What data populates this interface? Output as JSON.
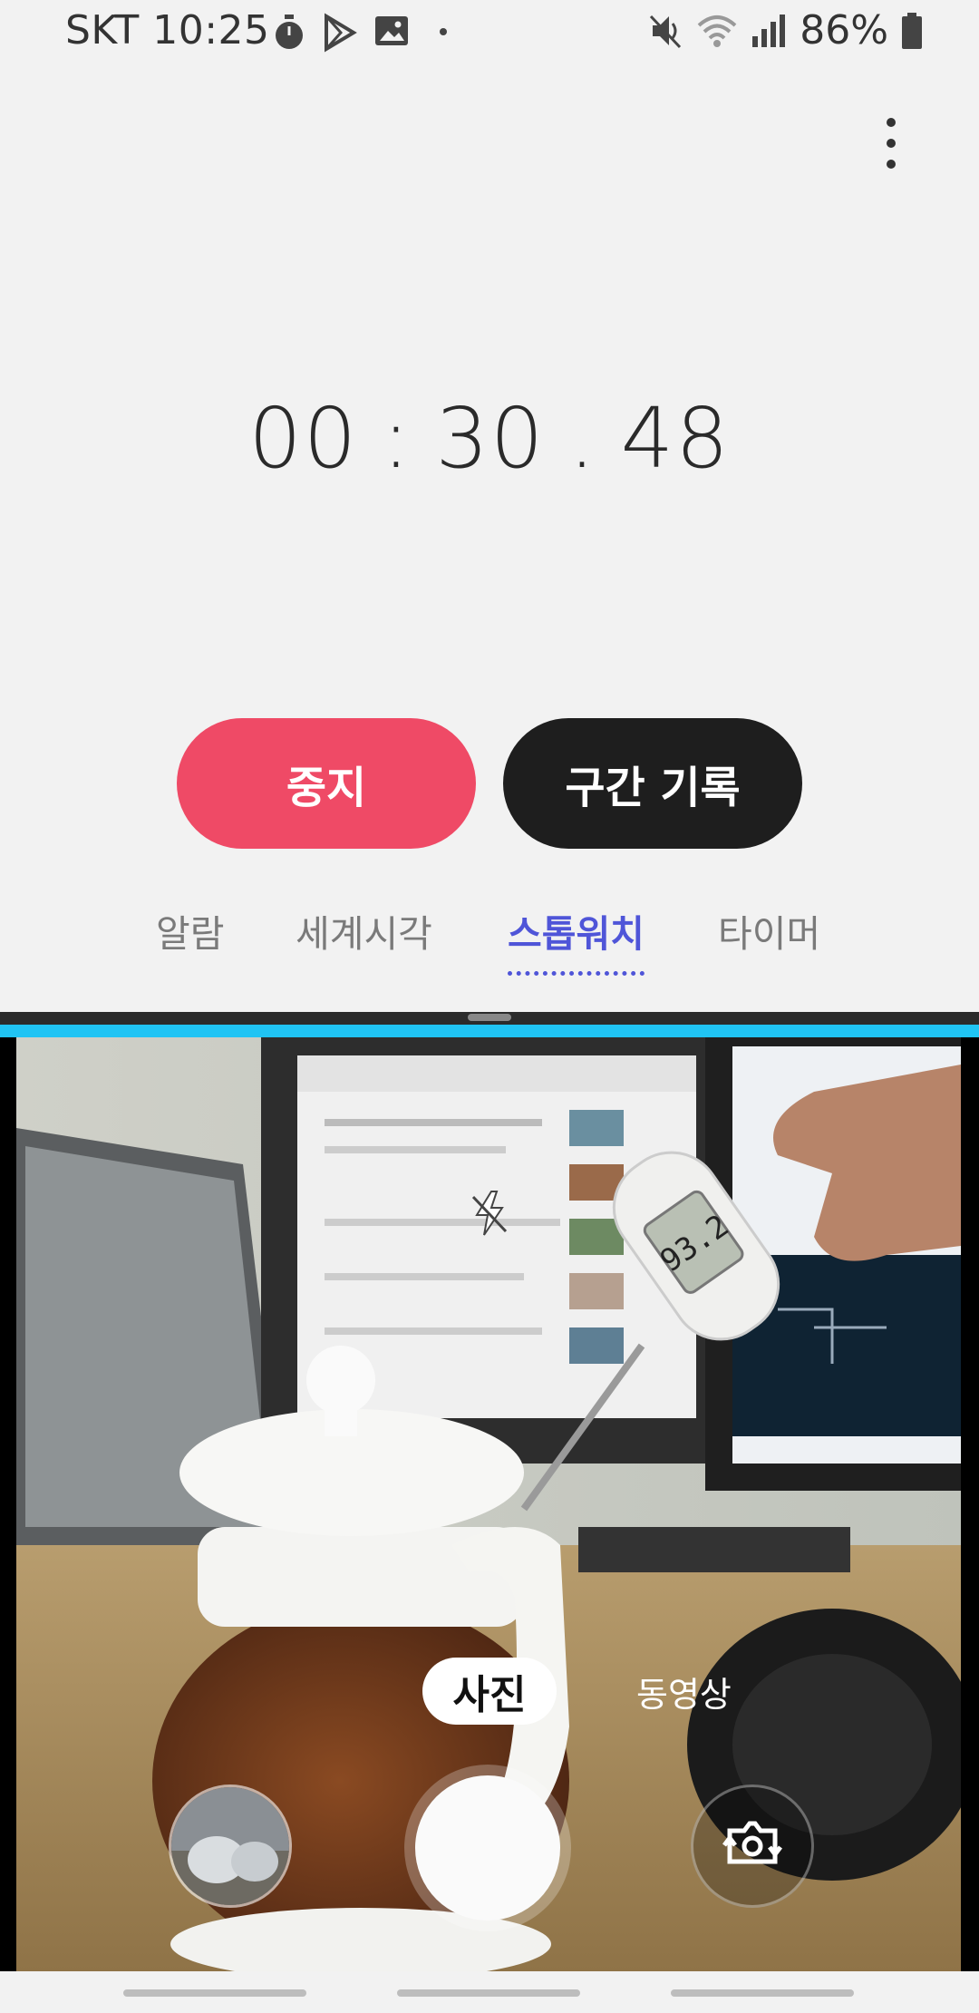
{
  "status_bar": {
    "carrier_time": "SKT 10:25",
    "battery": "86%",
    "icons": [
      "stopwatch-icon",
      "play-store-icon",
      "gallery-icon",
      "dot-icon",
      "mute-icon",
      "wifi-icon",
      "signal-icon",
      "battery-icon"
    ]
  },
  "stopwatch": {
    "minutes": "00",
    "seconds": "30",
    "hundredths": "48",
    "sep1": ":",
    "sep2": "."
  },
  "buttons": {
    "stop_label": "중지",
    "lap_label": "구간 기록"
  },
  "tabs": [
    {
      "label": "알람",
      "active": false
    },
    {
      "label": "세계시각",
      "active": false
    },
    {
      "label": "스톱워치",
      "active": true
    },
    {
      "label": "타이머",
      "active": false
    }
  ],
  "camera": {
    "mode_photo": "사진",
    "mode_video": "동영상",
    "display_reading": "93.2"
  },
  "colors": {
    "stop_button": "#ef4a66",
    "lap_button": "#1e1e1e",
    "active_tab": "#4f55d8",
    "split_divider": "#20c4f4"
  }
}
